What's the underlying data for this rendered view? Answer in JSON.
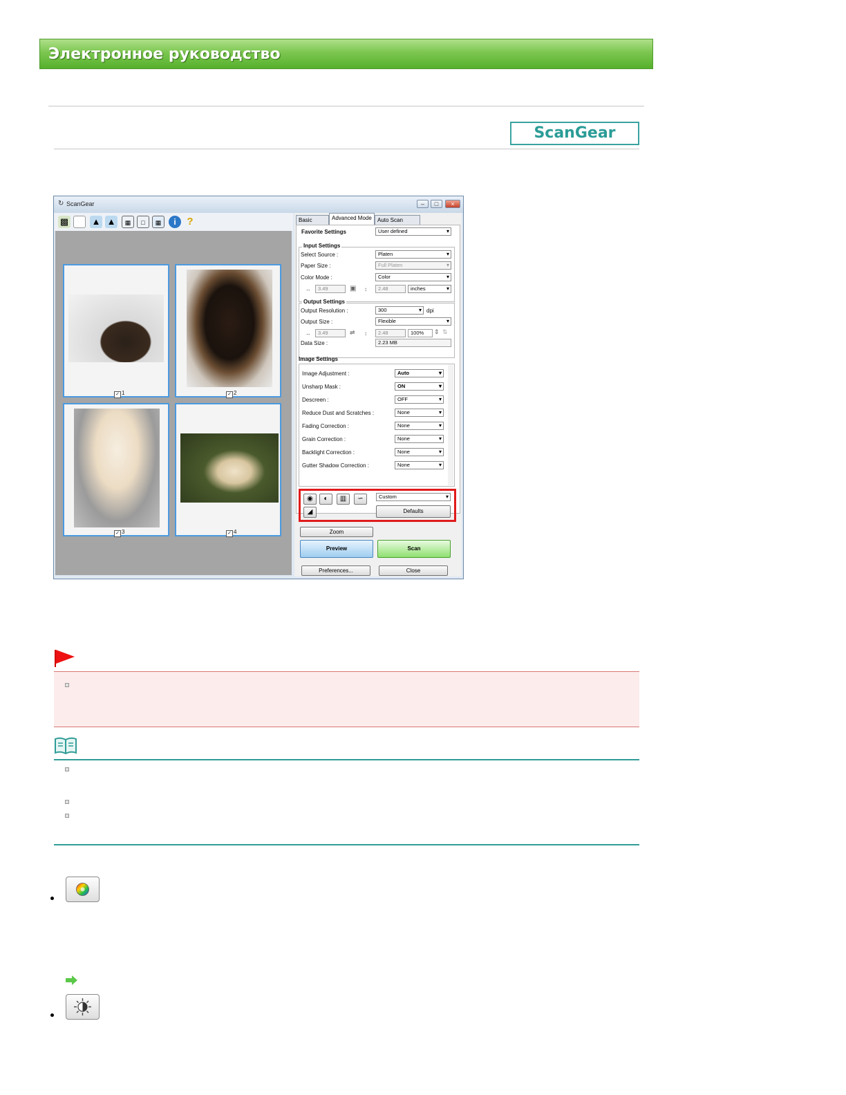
{
  "header": {
    "title": "Электронное руководство"
  },
  "badge": {
    "label": "ScanGear"
  },
  "window": {
    "title": "ScanGear",
    "controls": {
      "minimize": "–",
      "maximize": "□",
      "close": "×"
    },
    "thumbnails": [
      {
        "label": "1"
      },
      {
        "label": "2"
      },
      {
        "label": "3"
      },
      {
        "label": "4"
      }
    ],
    "tabs": [
      "Basic Mode",
      "Advanced Mode",
      "Auto Scan Mode"
    ],
    "favorite": {
      "label": "Favorite Settings",
      "value": "User defined"
    },
    "input": {
      "title": "Input Settings",
      "select_source_label": "Select Source :",
      "select_source": "Platen",
      "paper_size_label": "Paper Size :",
      "paper_size": "Full Platen",
      "color_mode_label": "Color Mode :",
      "color_mode": "Color",
      "width": "3.49",
      "height": "2.48",
      "unit": "inches"
    },
    "output": {
      "title": "Output Settings",
      "resolution_label": "Output Resolution :",
      "resolution": "300",
      "dpi": "dpi",
      "size_label": "Output Size :",
      "size": "Flexible",
      "width": "3.49",
      "height": "2.48",
      "scale": "100%",
      "data_size_label": "Data Size :",
      "data_size": "2.23 MB"
    },
    "image": {
      "title": "Image Settings",
      "rows": [
        {
          "label": "Image Adjustment :",
          "value": "Auto"
        },
        {
          "label": "Unsharp Mask :",
          "value": "ON"
        },
        {
          "label": "Descreen :",
          "value": "OFF"
        },
        {
          "label": "Reduce Dust and Scratches :",
          "value": "None"
        },
        {
          "label": "Fading Correction :",
          "value": "None"
        },
        {
          "label": "Grain Correction :",
          "value": "None"
        },
        {
          "label": "Backlight Correction :",
          "value": "None"
        },
        {
          "label": "Gutter Shadow Correction :",
          "value": "None"
        }
      ]
    },
    "color_adjust": {
      "preset": "Custom",
      "defaults": "Defaults"
    },
    "buttons": {
      "zoom": "Zoom",
      "preview": "Preview",
      "scan": "Scan",
      "preferences": "Preferences...",
      "close": "Close"
    }
  },
  "colors": {
    "banner_green": "#56b02c",
    "badge_teal": "#2b9c97",
    "alert_red": "#d97575",
    "note_teal": "#2f9c96"
  }
}
